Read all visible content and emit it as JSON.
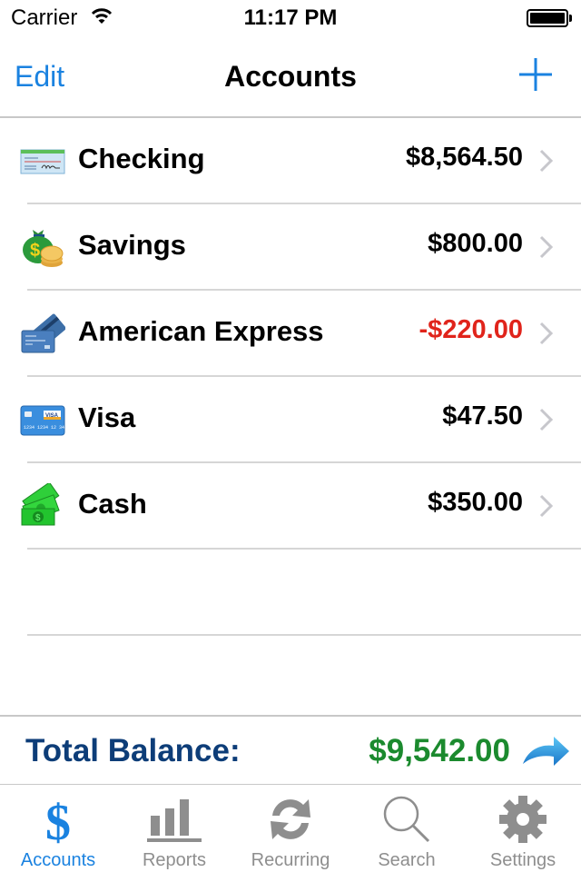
{
  "status_bar": {
    "carrier": "Carrier",
    "time": "11:17 PM",
    "battery_level": 1.0
  },
  "nav": {
    "edit_label": "Edit",
    "title": "Accounts",
    "add_icon": "plus-icon"
  },
  "accounts": [
    {
      "name": "Checking",
      "amount": "$8,564.50",
      "icon": "check-icon",
      "negative": false
    },
    {
      "name": "Savings",
      "amount": "$800.00",
      "icon": "money-bag-icon",
      "negative": false
    },
    {
      "name": "American Express",
      "amount": "-$220.00",
      "icon": "credit-cards-icon",
      "negative": true
    },
    {
      "name": "Visa",
      "amount": "$47.50",
      "icon": "visa-card-icon",
      "negative": false
    },
    {
      "name": "Cash",
      "amount": "$350.00",
      "icon": "cash-icon",
      "negative": false
    }
  ],
  "total": {
    "label": "Total Balance:",
    "value": "$9,542.00",
    "icon": "forward-arrow-icon"
  },
  "tabs": [
    {
      "label": "Accounts",
      "icon": "dollar-icon",
      "active": true
    },
    {
      "label": "Reports",
      "icon": "bar-chart-icon",
      "active": false
    },
    {
      "label": "Recurring",
      "icon": "refresh-icon",
      "active": false
    },
    {
      "label": "Search",
      "icon": "search-icon",
      "active": false
    },
    {
      "label": "Settings",
      "icon": "gear-icon",
      "active": false
    }
  ],
  "colors": {
    "accent": "#1a82e0",
    "negative": "#e0241b",
    "positive_total": "#1b8a2e",
    "total_label": "#0d3d78",
    "inactive": "#8e8e8e"
  }
}
